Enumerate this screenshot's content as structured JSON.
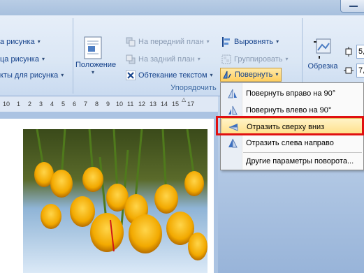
{
  "ribbon": {
    "left_group": {
      "items": [
        "а рисунка",
        "ца рисунка",
        "кты для рисунка"
      ]
    },
    "position_button": "Положение",
    "arrange": {
      "bring_front": "На передний план",
      "send_back": "На задний план",
      "wrap_text": "Обтекание текстом",
      "align": "Выровнять",
      "group": "Группировать",
      "rotate": "Повернуть",
      "label": "Упорядочить"
    },
    "crop_button": "Обрезка",
    "size_values": [
      "5,",
      "7,"
    ]
  },
  "ruler": {
    "numbers": [
      "10",
      "1",
      "2",
      "3",
      "4",
      "5",
      "6",
      "7",
      "8",
      "9",
      "10",
      "11",
      "12",
      "13",
      "14",
      "15",
      "16",
      "17"
    ]
  },
  "rotate_menu": {
    "items": [
      {
        "label": "Повернуть вправо на 90°",
        "icon": "rotate-right-icon"
      },
      {
        "label": "Повернуть влево на 90°",
        "icon": "rotate-left-icon"
      },
      {
        "label": "Отразить сверху вниз",
        "icon": "flip-vertical-icon"
      },
      {
        "label": "Отразить слева направо",
        "icon": "flip-horizontal-icon"
      },
      {
        "label": "Другие параметры поворота...",
        "icon": ""
      }
    ]
  },
  "colors": {
    "highlight": "#ffe08a",
    "annotation": "#e01010",
    "ribbon_text": "#15428b"
  }
}
